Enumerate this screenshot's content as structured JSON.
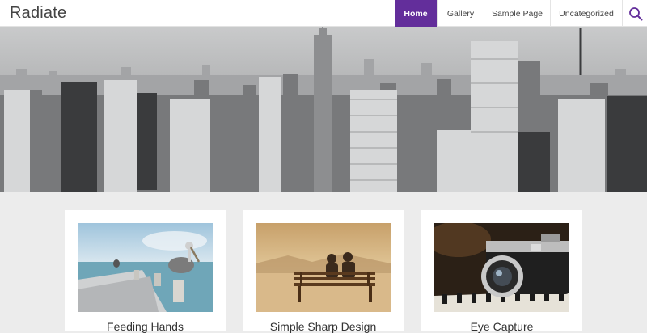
{
  "site": {
    "title": "Radiate"
  },
  "nav": {
    "items": [
      {
        "label": "Home",
        "active": true
      },
      {
        "label": "Gallery",
        "active": false
      },
      {
        "label": "Sample Page",
        "active": false
      },
      {
        "label": "Uncategorized",
        "active": false
      }
    ],
    "search_icon": "search-icon"
  },
  "hero": {
    "image": "city-skyline-grayscale"
  },
  "posts": [
    {
      "title": "Feeding Hands",
      "image": "pelican-on-pier"
    },
    {
      "title": "Simple Sharp Design",
      "image": "couple-on-bench"
    },
    {
      "title": "Eye Capture",
      "image": "vintage-camera"
    }
  ],
  "colors": {
    "accent": "#632e9b",
    "background": "#ececec"
  }
}
